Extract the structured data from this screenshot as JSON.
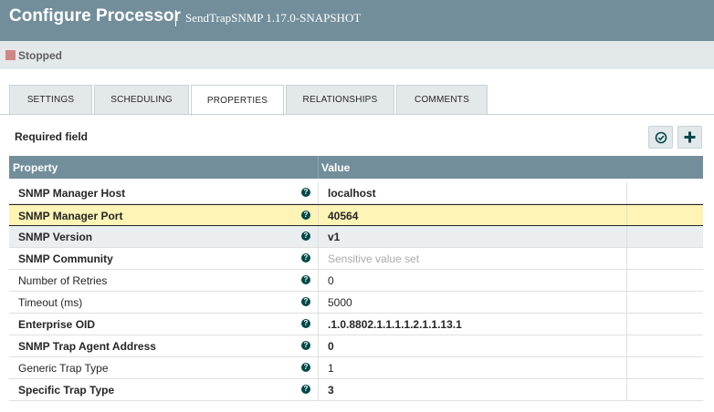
{
  "header": {
    "title": "Configure Processor",
    "subtitle": "SendTrapSNMP 1.17.0-SNAPSHOT",
    "bg_color": "#728e9b"
  },
  "status": {
    "label": "Stopped",
    "color": "#d18686"
  },
  "tabs": [
    {
      "label": "SETTINGS",
      "active": false
    },
    {
      "label": "SCHEDULING",
      "active": false
    },
    {
      "label": "PROPERTIES",
      "active": true
    },
    {
      "label": "RELATIONSHIPS",
      "active": false
    },
    {
      "label": "COMMENTS",
      "active": false
    }
  ],
  "properties_panel": {
    "required_label": "Required field",
    "verify_icon": "check-circle-icon",
    "add_icon": "plus-icon"
  },
  "table": {
    "columns": [
      "Property",
      "Value"
    ],
    "rows": [
      {
        "name": "SNMP Manager Host",
        "value": "localhost",
        "required": true,
        "state": "normal"
      },
      {
        "name": "SNMP Manager Port",
        "value": "40564",
        "required": true,
        "state": "selected"
      },
      {
        "name": "SNMP Version",
        "value": "v1",
        "required": true,
        "state": "grey"
      },
      {
        "name": "SNMP Community",
        "value": "Sensitive value set",
        "required": true,
        "state": "normal",
        "sensitive": true
      },
      {
        "name": "Number of Retries",
        "value": "0",
        "required": false,
        "state": "normal"
      },
      {
        "name": "Timeout (ms)",
        "value": "5000",
        "required": false,
        "state": "normal"
      },
      {
        "name": "Enterprise OID",
        "value": ".1.0.8802.1.1.1.1.2.1.1.13.1",
        "required": true,
        "state": "normal"
      },
      {
        "name": "SNMP Trap Agent Address",
        "value": "0",
        "required": true,
        "state": "normal"
      },
      {
        "name": "Generic Trap Type",
        "value": "1",
        "required": false,
        "state": "normal"
      },
      {
        "name": "Specific Trap Type",
        "value": "3",
        "required": true,
        "state": "normal"
      }
    ]
  }
}
